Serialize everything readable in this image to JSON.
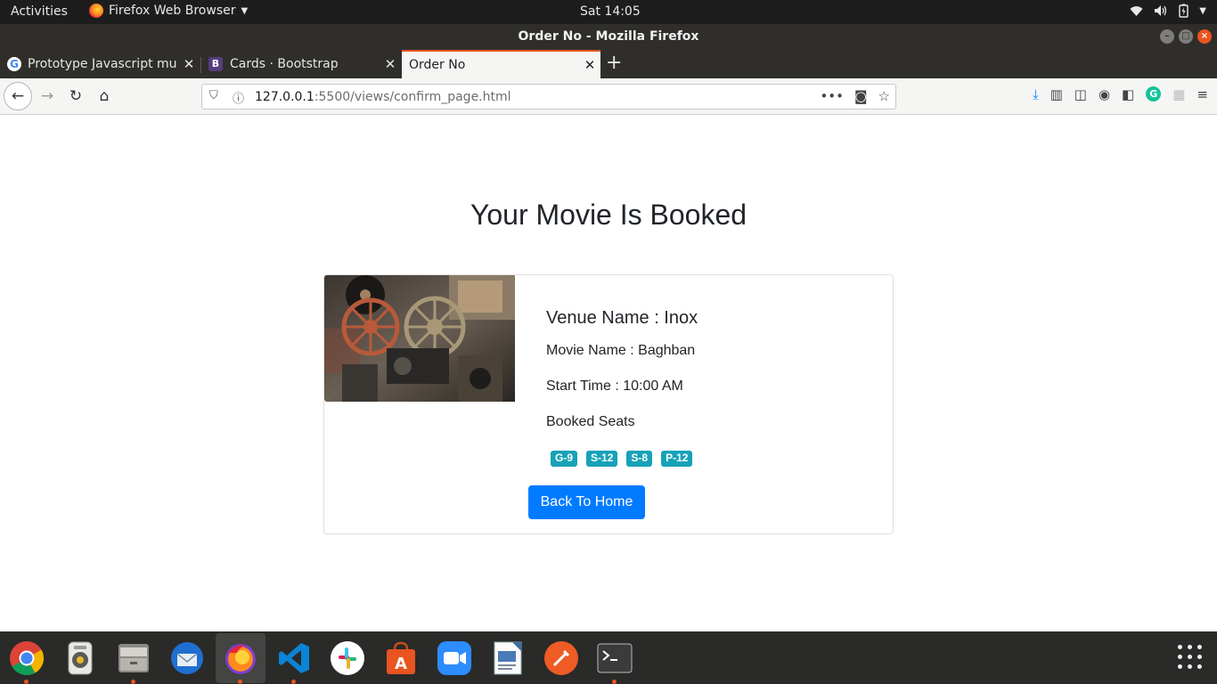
{
  "system_bar": {
    "activities": "Activities",
    "app_name": "Firefox Web Browser",
    "clock": "Sat 14:05"
  },
  "window": {
    "title": "Order No - Mozilla Firefox"
  },
  "tabs": [
    {
      "label": "Prototype Javascript mu",
      "favicon": "google-icon"
    },
    {
      "label": "Cards · Bootstrap",
      "favicon": "bootstrap-icon"
    },
    {
      "label": "Order No",
      "favicon": ""
    }
  ],
  "address_bar": {
    "url_host": "127.0.0.1",
    "url_rest": ":5500/views/confirm_page.html"
  },
  "page": {
    "heading": "Your Movie Is Booked",
    "venue": "Venue Name : Inox",
    "movie": "Movie Name : Baghban",
    "start_time": "Start Time : 10:00 AM",
    "seats_label": "Booked Seats",
    "seats": [
      "G-9",
      "S-12",
      "S-8",
      "P-12"
    ],
    "home_button": "Back To Home"
  },
  "dock": [
    "chrome-icon",
    "rhythmbox-icon",
    "files-icon",
    "thunderbird-icon",
    "firefox-icon",
    "vscode-icon",
    "slack-icon",
    "software-center-icon",
    "zoom-icon",
    "document-viewer-icon",
    "postman-icon",
    "terminal-icon",
    "show-applications-icon"
  ],
  "colors": {
    "accent_orange": "#e95420",
    "primary_button": "#007bff",
    "badge": "#17a2b8"
  }
}
